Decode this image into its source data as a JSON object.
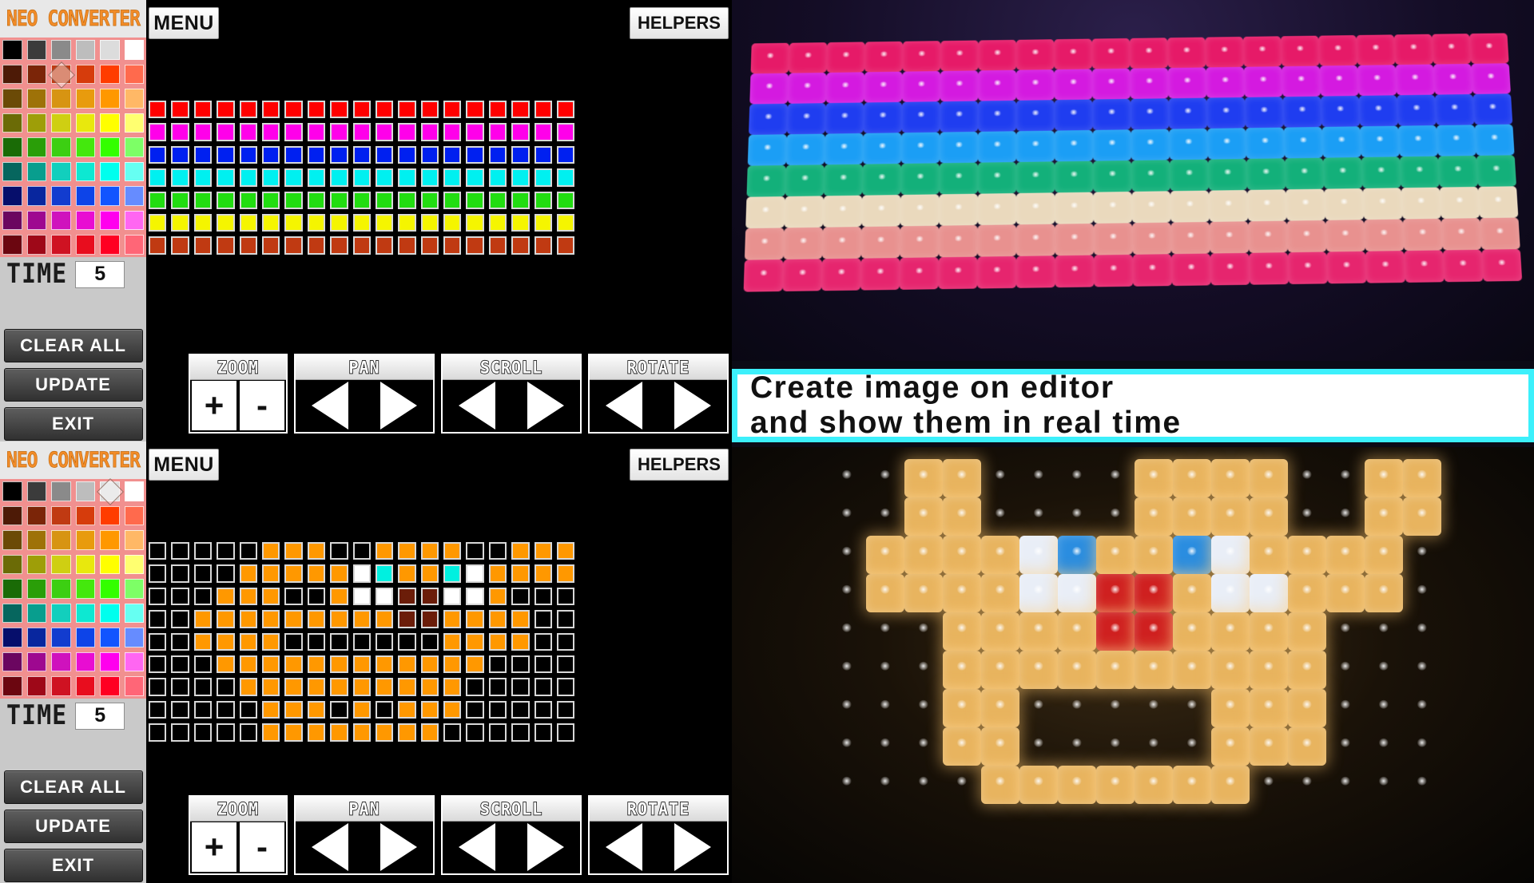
{
  "app": {
    "title": "NEO CONVERTER",
    "title_color": "#F28C28"
  },
  "editors": [
    {
      "id": "editor-top",
      "menu_label": "MENU",
      "helpers_label": "HELPERS",
      "time_label": "TIME",
      "time_value": "5",
      "buttons": [
        "CLEAR ALL",
        "UPDATE",
        "EXIT"
      ],
      "selected_swatch_index": 8,
      "controls": [
        {
          "label": "ZOOM",
          "type": "plusminus",
          "items": [
            "+",
            "-"
          ]
        },
        {
          "label": "PAN",
          "type": "arrows",
          "items": [
            "left-arrow",
            "right-arrow"
          ]
        },
        {
          "label": "SCROLL",
          "type": "arrows",
          "items": [
            "left-arrow",
            "right-arrow"
          ]
        },
        {
          "label": "ROTATE",
          "type": "arrows",
          "items": [
            "left-arrow",
            "right-arrow"
          ]
        }
      ],
      "grid": {
        "cols": 19,
        "rows": 7,
        "row_colors": [
          "#ff0000",
          "#ff00ea",
          "#0020f0",
          "#00f0f0",
          "#22dd11",
          "#f5f500",
          "#c03a12"
        ]
      }
    },
    {
      "id": "editor-bottom",
      "menu_label": "MENU",
      "helpers_label": "HELPERS",
      "time_label": "TIME",
      "time_value": "5",
      "buttons": [
        "CLEAR ALL",
        "UPDATE",
        "EXIT"
      ],
      "selected_swatch_index": 4,
      "controls": [
        {
          "label": "ZOOM",
          "type": "plusminus",
          "items": [
            "+",
            "-"
          ]
        },
        {
          "label": "PAN",
          "type": "arrows",
          "items": [
            "left-arrow",
            "right-arrow"
          ]
        },
        {
          "label": "SCROLL",
          "type": "arrows",
          "items": [
            "left-arrow",
            "right-arrow"
          ]
        },
        {
          "label": "ROTATE",
          "type": "arrows",
          "items": [
            "left-arrow",
            "right-arrow"
          ]
        }
      ],
      "grid": {
        "cols": 19,
        "rows": 9,
        "legend": {
          "K": "#000000",
          "O": "#ff9800",
          "W": "#ffffff",
          "C": "#00f0e0",
          "B": "#6b1d09"
        },
        "pattern": [
          "KKKKKOOOKKOOOOKKOOO",
          "KKKKOOOOOWCOOCWOOOO",
          "KKKOOOKKOWWBBWWOKKK",
          "KKOOOOOOOOOBBOOOOKK",
          "KKOOOOKKKKKKKOOOOKK",
          "KKKOOOOOOOOOOOOKKKK",
          "KKKKOOOOOOOOOOKKKKK",
          "KKKKKOOOKOKOOOKKKKK",
          "KKKKKOOOOOOOOKKKKKK"
        ]
      }
    }
  ],
  "palette_colors": [
    "#000000",
    "#3b3b3b",
    "#8a8a8a",
    "#bdbdbd",
    "#dcdcdc",
    "#ffffff",
    "#4d1a06",
    "#7b2508",
    "#c03a12",
    "#d63c0c",
    "#ff3c00",
    "#ff6a4d",
    "#6b4a06",
    "#9e7208",
    "#d79412",
    "#e89b0d",
    "#ff9800",
    "#ffb866",
    "#6b6b06",
    "#9e9e08",
    "#cfcf12",
    "#e8e80d",
    "#ffff00",
    "#ffff70",
    "#1a6b06",
    "#2a9e08",
    "#3ccf12",
    "#44e80d",
    "#33ff00",
    "#7dff66",
    "#06665e",
    "#089e8e",
    "#12cfbd",
    "#0de8d2",
    "#00ffee",
    "#66fff2",
    "#060e6b",
    "#08269e",
    "#123ccf",
    "#0d44e8",
    "#1155ff",
    "#668cff",
    "#6b0660",
    "#9e0890",
    "#cf12bd",
    "#e80dd2",
    "#ff00ee",
    "#ff66f2",
    "#6b0610",
    "#9e0818",
    "#cf1222",
    "#e80d1e",
    "#ff0022",
    "#ff6677"
  ],
  "photo": {
    "caption_lines": [
      "Create image on editor",
      "and show them in real time"
    ],
    "caption_border_color": "#3cf0fb",
    "top_panel": {
      "cols": 20,
      "rows": 8,
      "row_colors": [
        "#e61a68",
        "#d41ae0",
        "#1f3df0",
        "#1b9ef5",
        "#13b07a",
        "#ead9bd",
        "#e8918f",
        "#e6256e"
      ]
    },
    "bottom_panel": {
      "cols": 16,
      "rows": 9,
      "legend": {
        "K": "#000000",
        "O": "#e8b45f",
        "W": "#e9eef7",
        "C": "#2a8de0",
        "R": "#cf2020"
      },
      "pattern": [
        "KKOOKKKKOOOOKKOO",
        "KKOOKKKKOOOOKKOO",
        "KOOOOWCOOCWOOOOK",
        "KOOOOWWRROWWOOOK",
        "KKKOOOORROOOOKKK",
        "KKKOOOOOOOOOOKKK",
        "KKKOOKKKKKOOOKKK",
        "KKKOOKKKKKOOOKKK",
        "KKKKOOOOOOOKKKKK"
      ]
    }
  }
}
